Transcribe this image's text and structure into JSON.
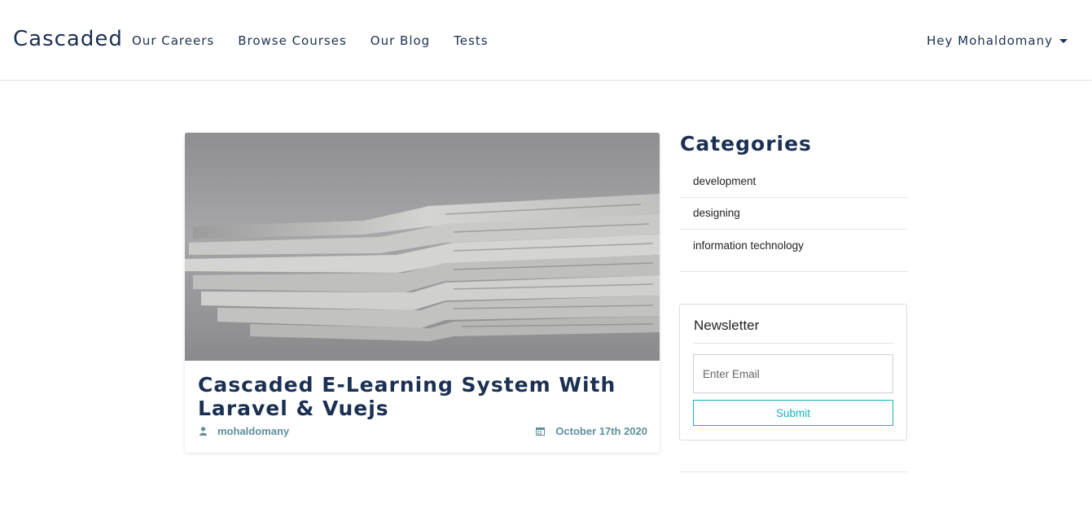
{
  "navbar": {
    "brand": "Cascaded",
    "links": [
      "Our Careers",
      "Browse Courses",
      "Our Blog",
      "Tests"
    ],
    "user_menu_label": "Hey Mohaldomany",
    "user_menu_icon": "caret-down-icon"
  },
  "post": {
    "title": "Cascaded E-Learning System With Laravel & Vuejs",
    "author": "mohaldomany",
    "author_icon": "user-icon",
    "date": "October 17th 2020",
    "date_icon": "calendar-icon",
    "image": "stack of newspapers"
  },
  "sidebar": {
    "categories_title": "Categories",
    "categories": [
      "development",
      "designing",
      "information technology"
    ],
    "newsletter": {
      "title": "Newsletter",
      "email_placeholder": "Enter Email",
      "email_value": "",
      "submit_label": "Submit"
    }
  },
  "colors": {
    "brand_text": "#1b3052",
    "accent": "#17b3be",
    "meta": "#5f8f98"
  }
}
